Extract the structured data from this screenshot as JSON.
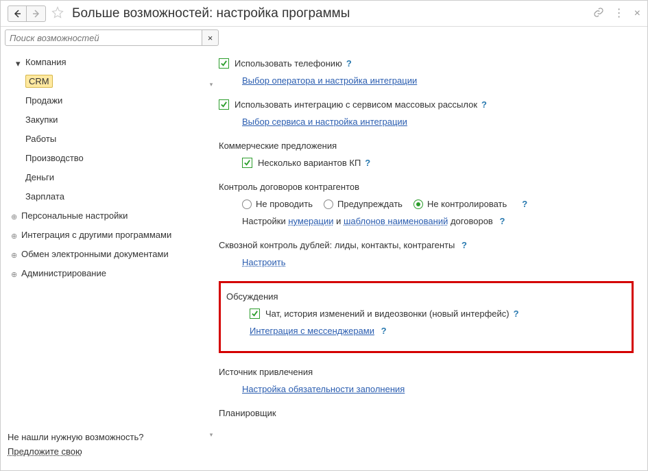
{
  "header": {
    "title": "Больше возможностей: настройка программы"
  },
  "search": {
    "placeholder": "Поиск возможностей"
  },
  "sidebar": {
    "items": [
      {
        "label": "Компания",
        "expandable": false,
        "chevron": true
      },
      {
        "label": "CRM",
        "active": true
      },
      {
        "label": "Продажи"
      },
      {
        "label": "Закупки"
      },
      {
        "label": "Работы"
      },
      {
        "label": "Производство"
      },
      {
        "label": "Деньги"
      },
      {
        "label": "Зарплата"
      },
      {
        "label": "Персональные настройки",
        "expandable": true
      },
      {
        "label": "Интеграция с другими программами",
        "expandable": true
      },
      {
        "label": "Обмен электронными документами",
        "expandable": true
      },
      {
        "label": "Администрирование",
        "expandable": true
      }
    ],
    "footer_question": "Не нашли нужную возможность?",
    "footer_link": "Предложите свою"
  },
  "content": {
    "telephony_checkbox": "Использовать телефонию",
    "telephony_link": "Выбор оператора и настройка интеграции",
    "mailing_checkbox": "Использовать интеграцию с сервисом массовых рассылок",
    "mailing_link": "Выбор сервиса и настройка интеграции",
    "kp_title": "Коммерческие предложения",
    "kp_checkbox": "Несколько вариантов КП",
    "contracts_title": "Контроль договоров контрагентов",
    "radio_opts": [
      "Не проводить",
      "Предупреждать",
      "Не контролировать"
    ],
    "contracts_settings_prefix": "Настройки ",
    "contracts_link1": "нумерации",
    "contracts_settings_mid": " и ",
    "contracts_link2": " шаблонов наименований",
    "contracts_settings_suffix": " договоров",
    "dupes_title": "Сквозной контроль дублей: лиды, контакты, контрагенты",
    "dupes_link": "Настроить",
    "discussions_title": "Обсуждения",
    "discussions_checkbox": "Чат, история изменений и видеозвонки (новый интерфейс)",
    "discussions_link": "Интеграция с мессенджерами",
    "source_title": "Источник привлечения",
    "source_link": "Настройка обязательности заполнения",
    "planner_title": "Планировщик"
  }
}
